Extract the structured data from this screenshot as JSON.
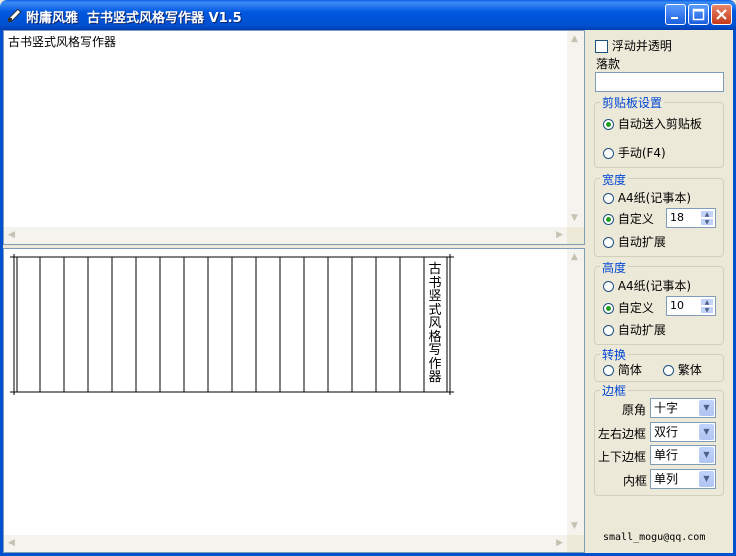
{
  "window": {
    "title": "附庸风雅  古书竖式风格写作器 V1.5"
  },
  "editor": {
    "text": "古书竖式风格写作器"
  },
  "preview": {
    "vertical_text": "古书竖式风格写作器",
    "column_count": 18
  },
  "panel": {
    "float_transparent_label": "浮动并透明",
    "signature_label": "落款",
    "signature_value": "",
    "clipboard": {
      "title": "剪贴板设置",
      "auto_label": "自动送入剪贴板",
      "manual_label": "手动(F4)",
      "selected": "auto"
    },
    "width": {
      "title": "宽度",
      "a4_label": "A4纸(记事本)",
      "custom_label": "自定义",
      "custom_value": "18",
      "auto_label": "自动扩展",
      "selected": "custom"
    },
    "height": {
      "title": "高度",
      "a4_label": "A4纸(记事本)",
      "custom_label": "自定义",
      "custom_value": "10",
      "auto_label": "自动扩展",
      "selected": "custom"
    },
    "convert": {
      "title": "转换",
      "simplified_label": "简体",
      "traditional_label": "繁体"
    },
    "border": {
      "title": "边框",
      "corner_label": "原角",
      "corner_value": "十字",
      "lr_label": "左右边框",
      "lr_value": "双行",
      "tb_label": "上下边框",
      "tb_value": "单行",
      "inner_label": "内框",
      "inner_value": "单列"
    },
    "email": "small_mogu@qq.com"
  }
}
